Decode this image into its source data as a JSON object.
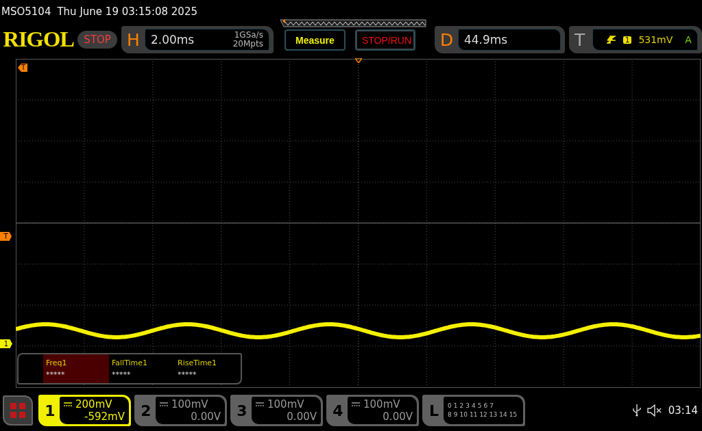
{
  "status_line": {
    "model": "MSO5104",
    "datetime": "Thu June 19 03:15:08 2025"
  },
  "toolbar": {
    "logo": "RIGOL",
    "run_state": "STOP",
    "horizontal": {
      "label": "H",
      "timebase": "2.00ms",
      "sample_rate": "1GSa/s",
      "memory_depth": "20Mpts"
    },
    "measure_button": "Measure",
    "stop_run_button": "STOP/RUN",
    "delay": {
      "label": "D",
      "value": "44.9ms"
    },
    "trigger": {
      "label": "T",
      "source": "1",
      "level": "531mV",
      "mode": "A"
    }
  },
  "markers": {
    "trigger_position": "T",
    "trigger_level": "T",
    "channel_1": "1"
  },
  "measurements": [
    {
      "name": "Freq1",
      "value": "*****",
      "selected": true
    },
    {
      "name": "FallTime1",
      "value": "*****",
      "selected": false
    },
    {
      "name": "RiseTime1",
      "value": "*****",
      "selected": false
    }
  ],
  "channels": [
    {
      "number": "1",
      "scale": "200mV",
      "offset": "-592mV",
      "on": true
    },
    {
      "number": "2",
      "scale": "100mV",
      "offset": "0.00V",
      "on": false
    },
    {
      "number": "3",
      "scale": "100mV",
      "offset": "0.00V",
      "on": false
    },
    {
      "number": "4",
      "scale": "100mV",
      "offset": "0.00V",
      "on": false
    }
  ],
  "logic": {
    "label": "L",
    "bits_row_1": [
      "0",
      "1",
      "2",
      "3",
      "4",
      "5",
      "6",
      "7"
    ],
    "bits_row_2": [
      "8",
      "9",
      "10",
      "11",
      "12",
      "13",
      "14",
      "15"
    ]
  },
  "status": {
    "time": "03:14"
  }
}
